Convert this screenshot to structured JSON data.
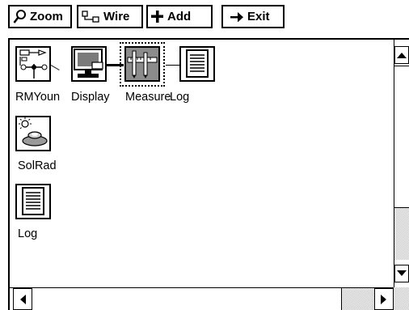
{
  "toolbar": {
    "zoom_label": "Zoom",
    "wire_label": "Wire",
    "add_label": "Add",
    "exit_label": "Exit"
  },
  "nodes": [
    {
      "label": "RMYoun",
      "icon": "anemometer-icon"
    },
    {
      "label": "Display",
      "icon": "monitor-icon"
    },
    {
      "label": "Measure",
      "icon": "caliper-icon",
      "selected": true
    },
    {
      "label": "Log",
      "icon": "document-icon"
    },
    {
      "label": "SolRad",
      "icon": "sun-cloud-icon"
    },
    {
      "label": "Log",
      "icon": "document-icon"
    }
  ],
  "colors": {
    "selected_fill": "#8c8c8c",
    "stipple": "#bdbdbd"
  }
}
